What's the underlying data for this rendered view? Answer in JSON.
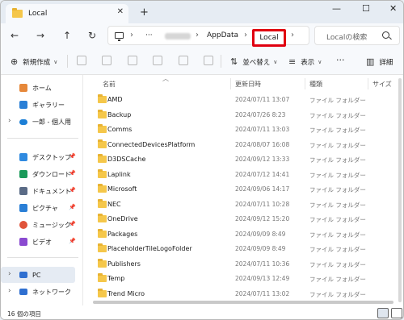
{
  "tab": {
    "title": "Local",
    "close_glyph": "✕",
    "add_glyph": "+"
  },
  "window_controls": {
    "minimize": "—",
    "maximize": "☐",
    "close": "✕"
  },
  "nav": {
    "back": "←",
    "forward": "→",
    "up": "↑",
    "refresh": "↻",
    "more": "···"
  },
  "address": {
    "segments": [
      "AppData",
      "Local"
    ],
    "chevron": "›",
    "highlight_color": "#e0000f"
  },
  "search": {
    "placeholder": "Localの検索"
  },
  "commandbar": {
    "new_label": "新規作成",
    "sort_label": "並べ替え",
    "view_label": "表示",
    "more_label": "···",
    "details_label": "詳細"
  },
  "sidebar": {
    "items": [
      {
        "label": "ホーム",
        "icon": "home-icon",
        "color": "#e6883a"
      },
      {
        "label": "ギャラリー",
        "icon": "gallery-icon",
        "color": "#2a7fd6"
      },
      {
        "label": "一郎 - 個人用",
        "icon": "cloud-icon",
        "color": "#1c7fd6"
      },
      {
        "label": "デスクトップ",
        "icon": "desktop-icon",
        "color": "#2f8ae0"
      },
      {
        "label": "ダウンロード",
        "icon": "download-icon",
        "color": "#1a9a5a"
      },
      {
        "label": "ドキュメント",
        "icon": "documents-icon",
        "color": "#5a6b86"
      },
      {
        "label": "ピクチャ",
        "icon": "pictures-icon",
        "color": "#2a7fd6"
      },
      {
        "label": "ミュージック",
        "icon": "music-icon",
        "color": "#e0533a"
      },
      {
        "label": "ビデオ",
        "icon": "videos-icon",
        "color": "#8a4ad0"
      },
      {
        "label": "PC",
        "icon": "pc-icon",
        "color": "#2f6fd0"
      },
      {
        "label": "ネットワーク",
        "icon": "network-icon",
        "color": "#2f6fd0"
      }
    ]
  },
  "columns": {
    "name": "名前",
    "date": "更新日時",
    "type": "種類",
    "size": "サイズ"
  },
  "files": [
    {
      "name": "AMD",
      "date": "2024/07/11 13:07",
      "type": "ファイル フォルダー"
    },
    {
      "name": "Backup",
      "date": "2024/07/26 8:23",
      "type": "ファイル フォルダー"
    },
    {
      "name": "Comms",
      "date": "2024/07/11 13:03",
      "type": "ファイル フォルダー"
    },
    {
      "name": "ConnectedDevicesPlatform",
      "date": "2024/08/07 16:08",
      "type": "ファイル フォルダー"
    },
    {
      "name": "D3DSCache",
      "date": "2024/09/12 13:33",
      "type": "ファイル フォルダー"
    },
    {
      "name": "Laplink",
      "date": "2024/07/12 14:41",
      "type": "ファイル フォルダー"
    },
    {
      "name": "Microsoft",
      "date": "2024/09/06 14:17",
      "type": "ファイル フォルダー"
    },
    {
      "name": "NEC",
      "date": "2024/07/11 10:28",
      "type": "ファイル フォルダー"
    },
    {
      "name": "OneDrive",
      "date": "2024/09/12 15:20",
      "type": "ファイル フォルダー"
    },
    {
      "name": "Packages",
      "date": "2024/09/09 8:49",
      "type": "ファイル フォルダー"
    },
    {
      "name": "PlaceholderTileLogoFolder",
      "date": "2024/09/09 8:49",
      "type": "ファイル フォルダー"
    },
    {
      "name": "Publishers",
      "date": "2024/07/11 10:36",
      "type": "ファイル フォルダー"
    },
    {
      "name": "Temp",
      "date": "2024/09/13 12:49",
      "type": "ファイル フォルダー"
    },
    {
      "name": "Trend Micro",
      "date": "2024/07/11 13:02",
      "type": "ファイル フォルダー"
    }
  ],
  "status": {
    "item_count": "16 個の項目"
  }
}
